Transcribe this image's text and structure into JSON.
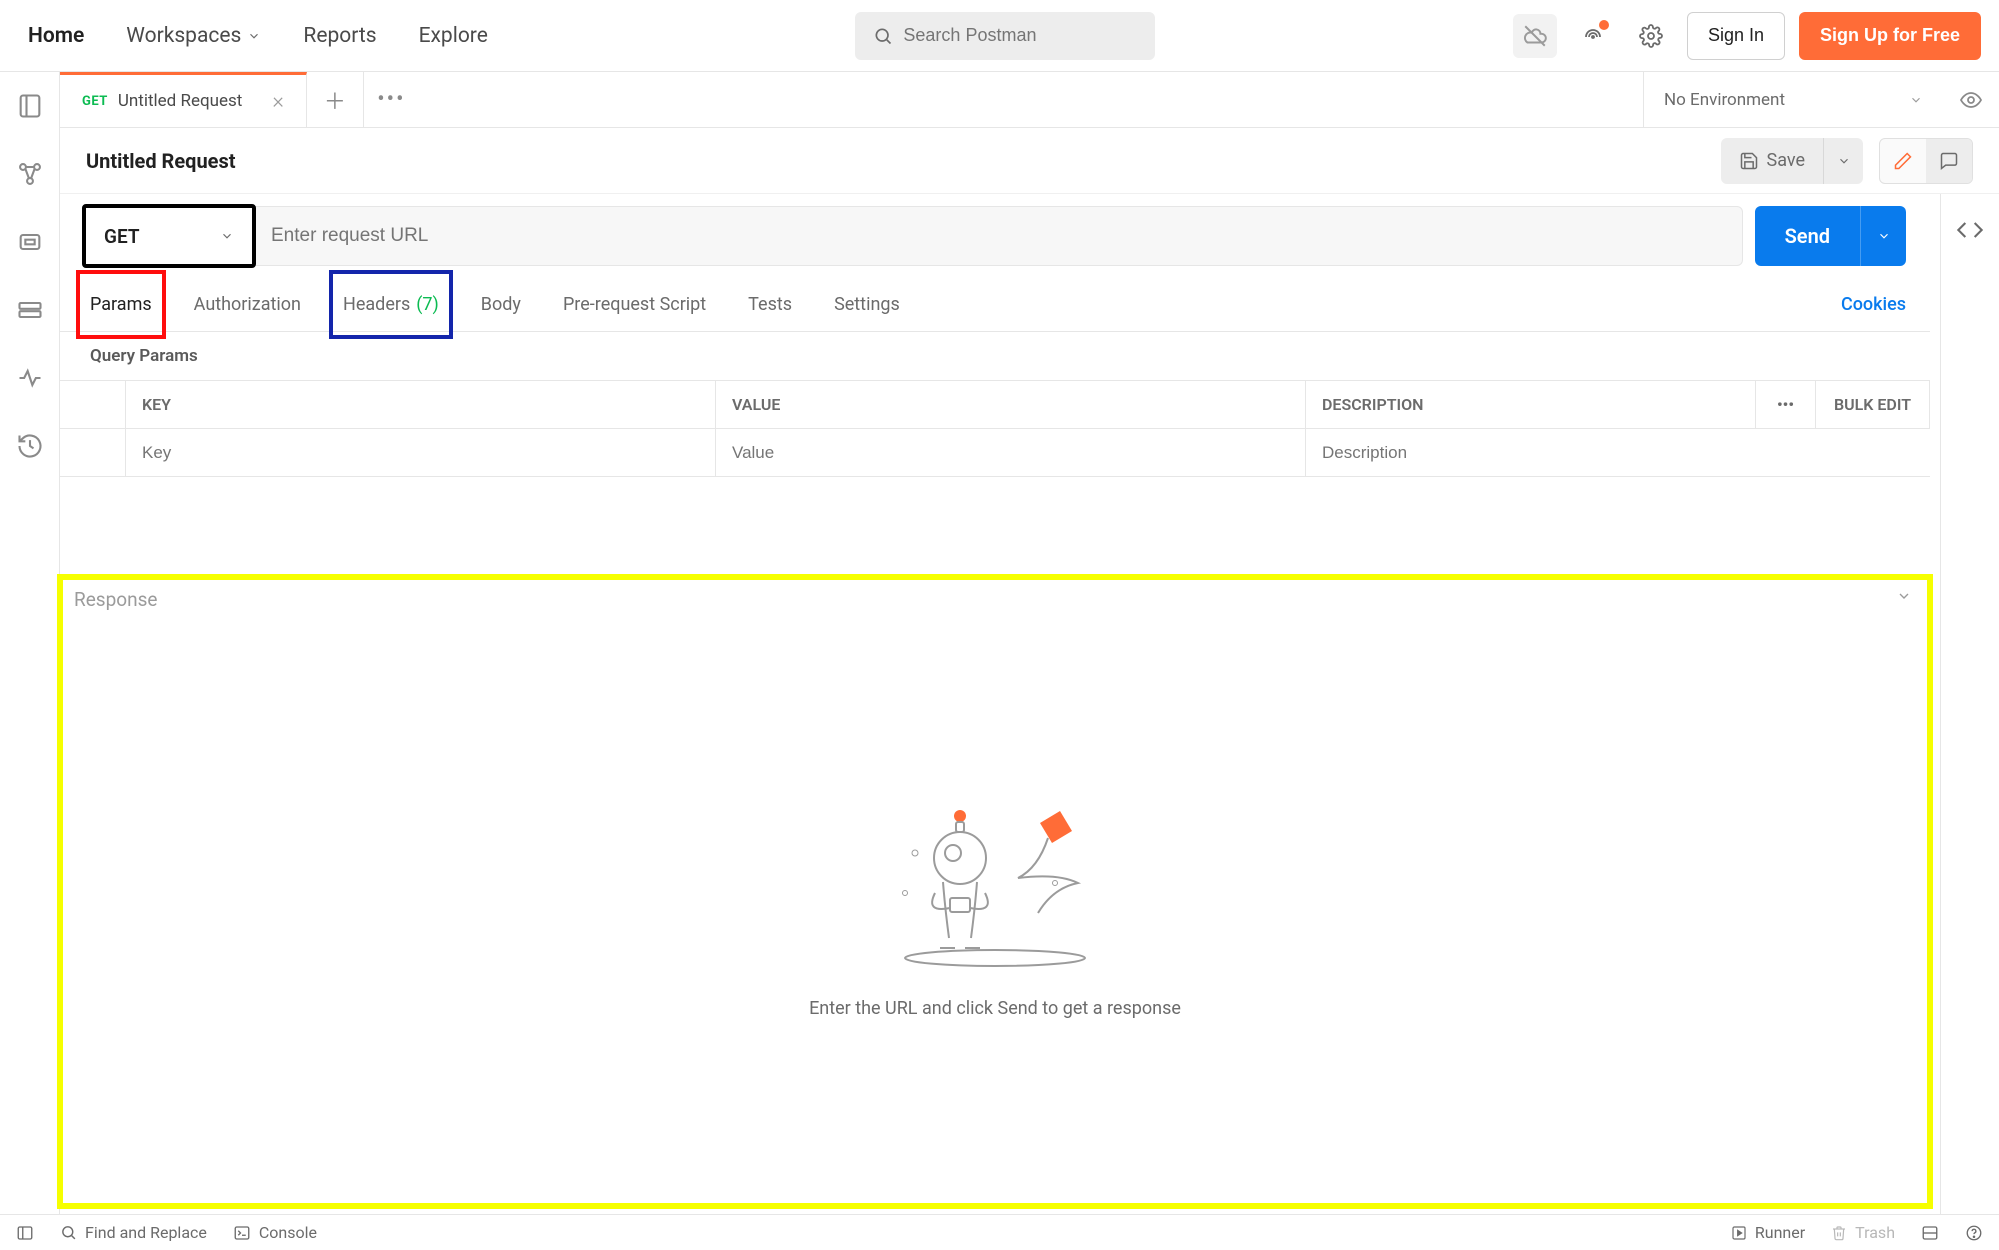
{
  "topnav": {
    "home": "Home",
    "workspaces": "Workspaces",
    "reports": "Reports",
    "explore": "Explore",
    "search_placeholder": "Search Postman",
    "sign_in": "Sign In",
    "sign_up": "Sign Up for Free"
  },
  "tab": {
    "method": "GET",
    "title": "Untitled Request"
  },
  "env": {
    "label": "No Environment"
  },
  "request": {
    "title": "Untitled Request",
    "save_label": "Save",
    "method": "GET",
    "url_placeholder": "Enter request URL",
    "send_label": "Send"
  },
  "req_tabs": {
    "params": "Params",
    "authorization": "Authorization",
    "headers": "Headers",
    "headers_count": "(7)",
    "body": "Body",
    "prerequest": "Pre-request Script",
    "tests": "Tests",
    "settings": "Settings",
    "cookies": "Cookies"
  },
  "query_params": {
    "label": "Query Params",
    "headers": {
      "key": "KEY",
      "value": "VALUE",
      "description": "DESCRIPTION"
    },
    "bulk_edit": "Bulk Edit",
    "placeholders": {
      "key": "Key",
      "value": "Value",
      "description": "Description"
    }
  },
  "response": {
    "title": "Response",
    "empty": "Enter the URL and click Send to get a response"
  },
  "footer": {
    "find_replace": "Find and Replace",
    "console": "Console",
    "runner": "Runner",
    "trash": "Trash"
  }
}
